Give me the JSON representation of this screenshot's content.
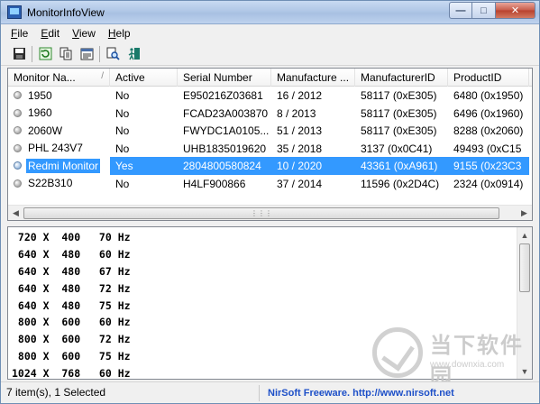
{
  "window": {
    "title": "MonitorInfoView"
  },
  "menu": [
    {
      "label": "File",
      "key": "F",
      "rest": "ile"
    },
    {
      "label": "Edit",
      "key": "E",
      "rest": "dit"
    },
    {
      "label": "View",
      "key": "V",
      "rest": "iew"
    },
    {
      "label": "Help",
      "key": "H",
      "rest": "elp"
    }
  ],
  "toolbar": [
    "save-icon",
    "refresh-icon",
    "copy-icon",
    "properties-icon",
    "find-icon",
    "exit-icon"
  ],
  "list": {
    "columns": [
      "Monitor Na...",
      "Active",
      "Serial Number",
      "Manufacture ...",
      "ManufacturerID",
      "ProductID"
    ],
    "sort_indicator": "/",
    "rows": [
      {
        "name": "1950",
        "active": "No",
        "serial": "E950216Z03681",
        "manufacture": "16 / 2012",
        "mfr_id": "58117 (0xE305)",
        "product_id": "6480 (0x1950)",
        "selected": false
      },
      {
        "name": "1960",
        "active": "No",
        "serial": "FCAD23A003870",
        "manufacture": "8 / 2013",
        "mfr_id": "58117 (0xE305)",
        "product_id": "6496 (0x1960)",
        "selected": false
      },
      {
        "name": "2060W",
        "active": "No",
        "serial": "FWYDC1A0105...",
        "manufacture": "51 / 2013",
        "mfr_id": "58117 (0xE305)",
        "product_id": "8288 (0x2060)",
        "selected": false
      },
      {
        "name": "PHL 243V7",
        "active": "No",
        "serial": "UHB1835019620",
        "manufacture": "35 / 2018",
        "mfr_id": "3137 (0x0C41)",
        "product_id": "49493 (0xC15",
        "selected": false
      },
      {
        "name": "Redmi Monitor",
        "active": "Yes",
        "serial": "2804800580824",
        "manufacture": "10 / 2020",
        "mfr_id": "43361 (0xA961)",
        "product_id": "9155 (0x23C3",
        "selected": true
      },
      {
        "name": "S22B310",
        "active": "No",
        "serial": "H4LF900866",
        "manufacture": "37 / 2014",
        "mfr_id": "11596 (0x2D4C)",
        "product_id": "2324 (0x0914)",
        "selected": false
      }
    ]
  },
  "modes": [
    " 720 X  400   70 Hz",
    " 640 X  480   60 Hz",
    " 640 X  480   67 Hz",
    " 640 X  480   72 Hz",
    " 640 X  480   75 Hz",
    " 800 X  600   60 Hz",
    " 800 X  600   72 Hz",
    " 800 X  600   75 Hz",
    "1024 X  768   60 Hz"
  ],
  "status": {
    "left": "7 item(s), 1 Selected",
    "right": "NirSoft Freeware.  http://www.nirsoft.net"
  },
  "watermark": {
    "text": "当下软件园",
    "url": "www.downxia.com"
  }
}
